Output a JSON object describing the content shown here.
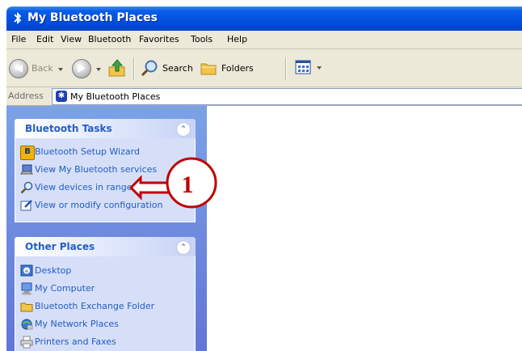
{
  "window": {
    "title": "My Bluetooth Places",
    "title_icon": "bluetooth-icon"
  },
  "menu": {
    "items": [
      "File",
      "Edit",
      "View",
      "Bluetooth",
      "Favorites",
      "Tools",
      "Help"
    ]
  },
  "toolbar": {
    "back_label": "Back",
    "search_label": "Search",
    "folders_label": "Folders"
  },
  "address": {
    "label": "Address",
    "value": "My Bluetooth Places"
  },
  "tasks_panel": {
    "title": "Bluetooth Tasks",
    "items": [
      {
        "label": "Bluetooth Setup Wizard",
        "icon": "bluetooth-wizard-icon"
      },
      {
        "label": "View My Bluetooth services",
        "icon": "laptop-icon"
      },
      {
        "label": "View devices in range",
        "icon": "magnifier-icon"
      },
      {
        "label": "View or modify configuration",
        "icon": "config-icon"
      }
    ]
  },
  "places_panel": {
    "title": "Other Places",
    "items": [
      {
        "label": "Desktop",
        "icon": "desktop-icon"
      },
      {
        "label": "My Computer",
        "icon": "computer-icon"
      },
      {
        "label": "Bluetooth Exchange Folder",
        "icon": "folder-icon"
      },
      {
        "label": "My Network Places",
        "icon": "network-icon"
      },
      {
        "label": "Printers and Faxes",
        "icon": "printer-icon"
      }
    ]
  },
  "annotation": {
    "number": "1",
    "color": "#c00000"
  },
  "colors": {
    "titlebar": "#0050e0",
    "task_link": "#215dc6",
    "left_pane": "#7ba2e7"
  }
}
